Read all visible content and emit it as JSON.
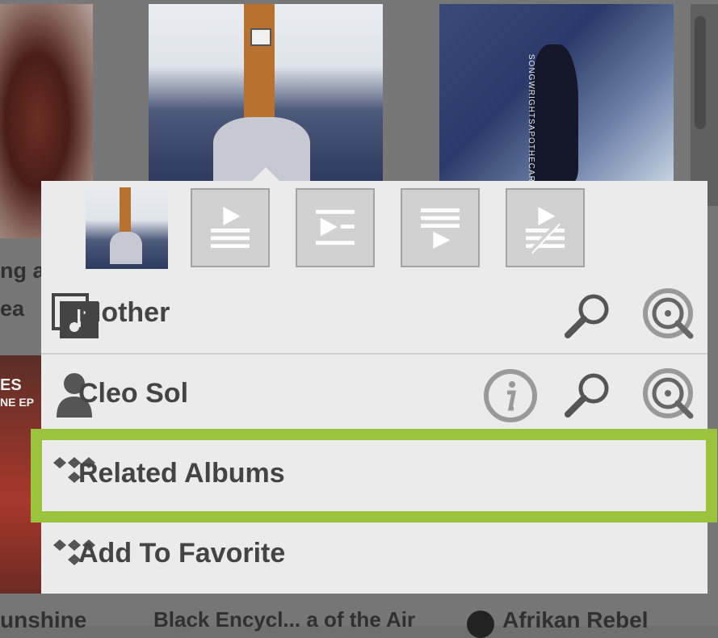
{
  "background": {
    "fragments": {
      "left_line1": "ng a g",
      "left_line2": "ea",
      "left_album_top": "ES",
      "left_album_sub": "NE EP",
      "bottom_left": "unshine",
      "bottom_mid": "Black Encycl... a of the Air",
      "bottom_right": "Afrikan Rebel"
    },
    "album_art_text": "SONGWRIGHTSAPOTHECARYL"
  },
  "menu": {
    "actions": [
      {
        "name": "play-now",
        "icon": "play-now-icon"
      },
      {
        "name": "play-next",
        "icon": "play-next-icon"
      },
      {
        "name": "add-to-end",
        "icon": "add-to-queue-icon"
      },
      {
        "name": "replace-queue",
        "icon": "replace-queue-icon"
      }
    ],
    "rows": [
      {
        "label": "Mother",
        "icon": "album-icon"
      },
      {
        "label": "Cleo Sol",
        "icon": "artist-icon"
      },
      {
        "label": "Related Albums",
        "icon": "tidal-icon"
      },
      {
        "label": "Add To Favorite",
        "icon": "tidal-icon"
      }
    ]
  },
  "colors": {
    "highlight": "#9bc33d",
    "menu_bg": "#ebebeb",
    "text": "#444444"
  }
}
